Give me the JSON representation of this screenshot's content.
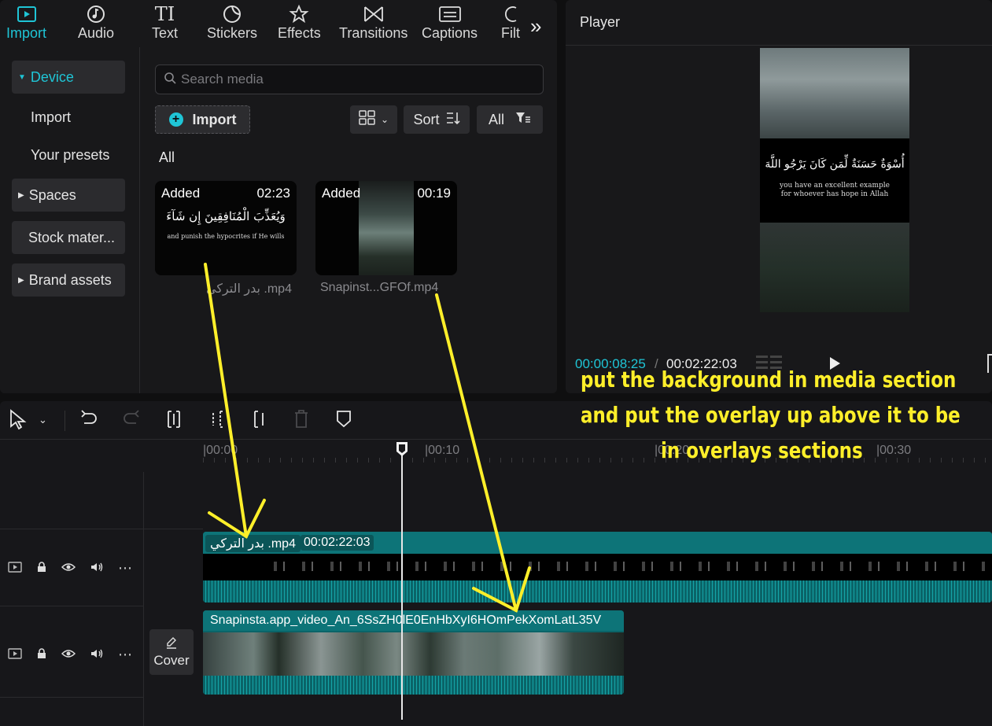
{
  "tabs": [
    {
      "label": "Import",
      "icon": "import-icon",
      "active": true
    },
    {
      "label": "Audio",
      "icon": "audio-icon"
    },
    {
      "label": "Text",
      "icon": "text-icon"
    },
    {
      "label": "Stickers",
      "icon": "stickers-icon"
    },
    {
      "label": "Effects",
      "icon": "effects-icon"
    },
    {
      "label": "Transitions",
      "icon": "transitions-icon"
    },
    {
      "label": "Captions",
      "icon": "captions-icon"
    },
    {
      "label": "Filt",
      "icon": "filters-icon"
    }
  ],
  "sidebar": {
    "items": [
      {
        "label": "Device"
      },
      {
        "label": "Import"
      },
      {
        "label": "Your presets"
      },
      {
        "label": "Spaces"
      },
      {
        "label": "Stock mater..."
      },
      {
        "label": "Brand assets"
      }
    ]
  },
  "search": {
    "placeholder": "Search media"
  },
  "toolbar": {
    "import_label": "Import",
    "sort_label": "Sort",
    "filter_label": "All"
  },
  "section_label": "All",
  "media": [
    {
      "badge": "Added",
      "duration": "02:23",
      "caption": "بدر التركي .mp4",
      "text_ar": "وَيُعَذِّبَ الْمُنَافِقِينَ إِن شَآءَ",
      "text_en": "and punish the hypocrites if He wills"
    },
    {
      "badge": "Added",
      "duration": "00:19",
      "caption": "Snapinst...GFOf.mp4"
    }
  ],
  "player": {
    "title": "Player",
    "current_time": "00:00:08:25",
    "separator": "/",
    "total_time": "00:02:22:03",
    "text_ar": "أُسْوَةٌ حَسَنَةٌ لِّمَن كَانَ يَرْجُو اللَّهَ",
    "text_en": "you have an excellent example for whoever has hope in Allah"
  },
  "ruler": {
    "labels": [
      "|00:00",
      "|00:10",
      "|00:20",
      "|00:30"
    ]
  },
  "tracks": [
    {
      "name": "بدر التركي .mp4",
      "duration": "00:02:22:03"
    },
    {
      "name": "Snapinsta.app_video_An_6SsZH0lE0EnHbXyI6HOmPekXomLatL35V"
    }
  ],
  "cover_label": "Cover",
  "annotation": {
    "lines": [
      "put the background in media section",
      "and put the overlay up above it to be",
      "in overlays sections"
    ]
  },
  "colors": {
    "accent": "#1fc5d6",
    "track": "#0c6e72",
    "annotation": "#ffef2a"
  }
}
